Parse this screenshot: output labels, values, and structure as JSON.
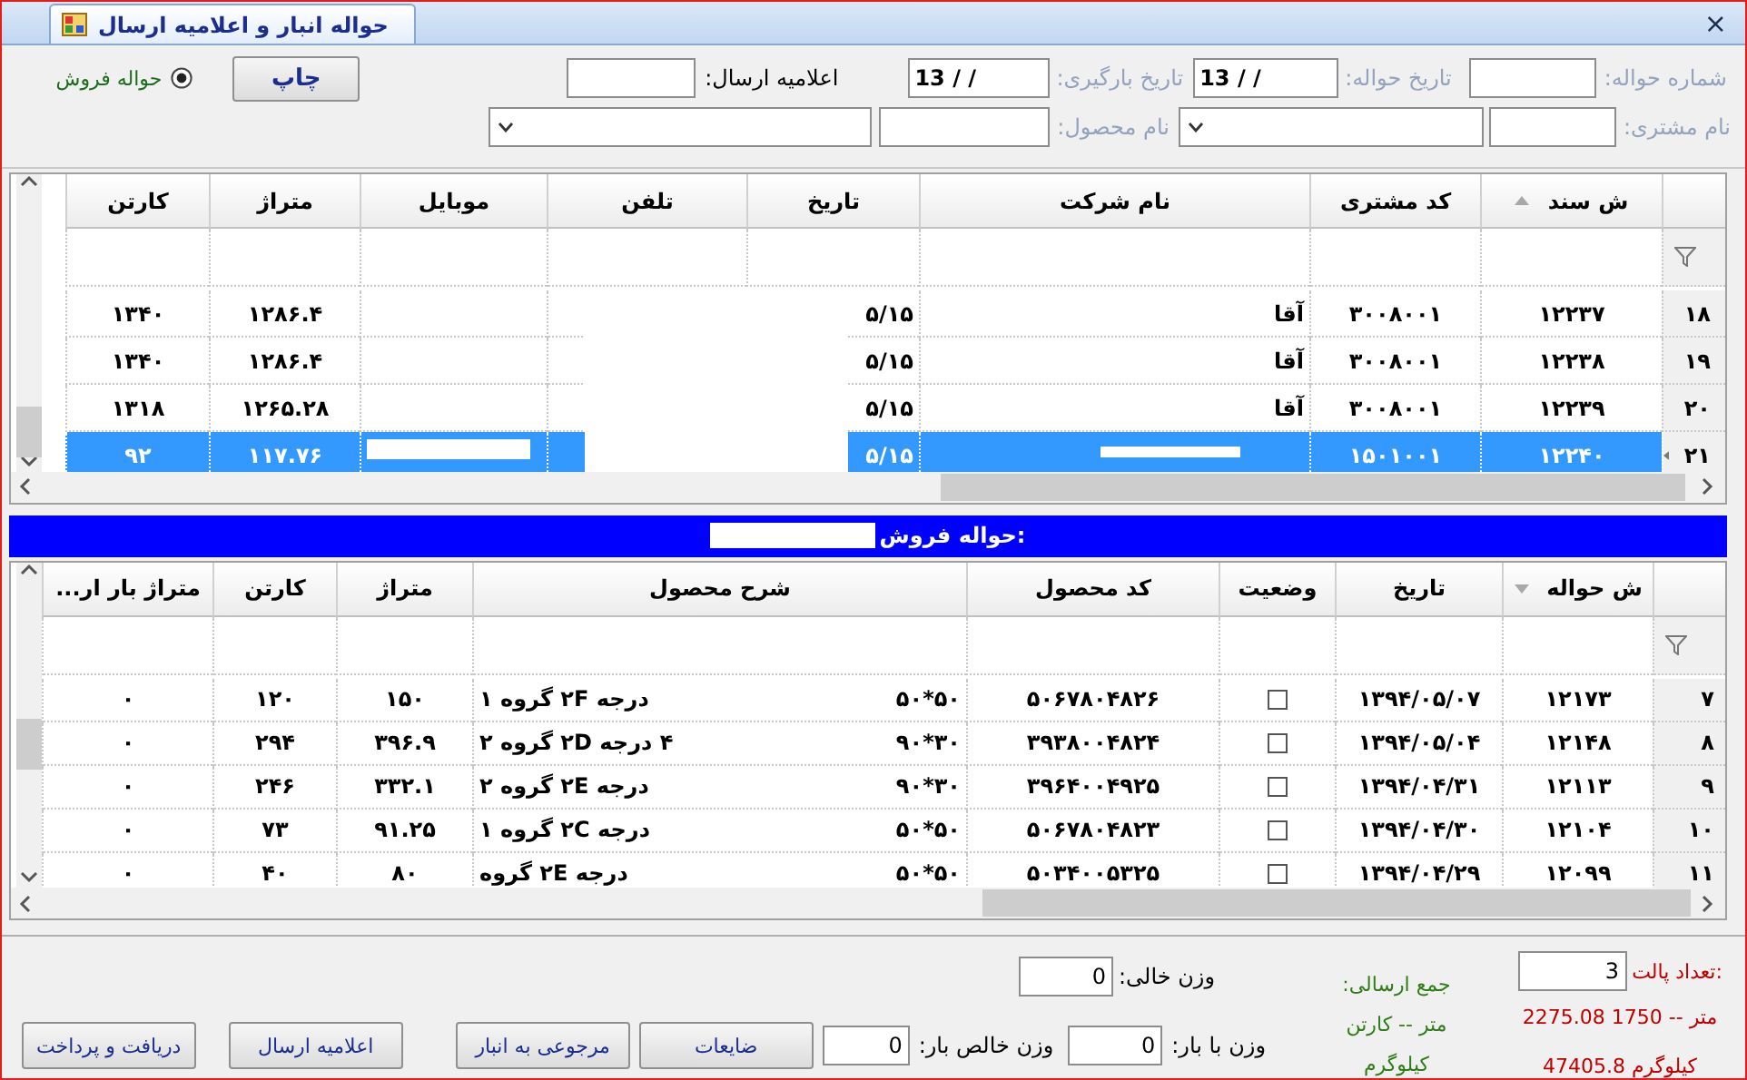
{
  "window": {
    "title": "حواله انبار و اعلامیه ارسال",
    "close": "×"
  },
  "form": {
    "invoice_no": {
      "label": "شماره حواله:",
      "disabled": true
    },
    "invoice_date": {
      "label": "تاریخ حواله:",
      "disabled": true,
      "value": "13 / /"
    },
    "loading_date": {
      "label": "تاریخ بارگیری:",
      "disabled": true,
      "value": "13 / /"
    },
    "dispatch_notice": {
      "label": "اعلامیه ارسال:",
      "disabled": false
    },
    "print_button": "چاپ",
    "radio": {
      "label": "حواله فروش",
      "selected": true
    },
    "customer": {
      "label": "نام مشتری:",
      "disabled": true
    },
    "product": {
      "label": "نام محصول:",
      "disabled": true
    }
  },
  "orders_grid": {
    "sort_descending": false,
    "columns": [
      {
        "label": "ش سند",
        "sorted": true,
        "kind": "center"
      },
      {
        "label": "کد مشتری",
        "sorted": false,
        "kind": "center"
      },
      {
        "label": "نام شرکت",
        "sorted": false,
        "kind": "start"
      },
      {
        "label": "تاریخ",
        "sorted": false,
        "kind": "start"
      },
      {
        "label": "تلفن",
        "sorted": false,
        "kind": "center"
      },
      {
        "label": "موبایل",
        "sorted": false,
        "kind": "center"
      },
      {
        "label": "متراژ",
        "sorted": false,
        "kind": "center"
      },
      {
        "label": "کارتن",
        "sorted": false,
        "kind": "center"
      }
    ],
    "rows": [
      {
        "number": "۱۸",
        "selected": false,
        "cells": [
          "۱۲۲۳۷",
          "۳۰۰۸۰۰۱",
          "آقا",
          "۵/۱۵",
          null,
          null,
          "۱۲۸۶.۴",
          "۱۳۴۰"
        ]
      },
      {
        "number": "۱۹",
        "selected": false,
        "cells": [
          "۱۲۲۳۸",
          "۳۰۰۸۰۰۱",
          "آقا",
          "۵/۱۵",
          null,
          null,
          "۱۲۸۶.۴",
          "۱۳۴۰"
        ]
      },
      {
        "number": "۲۰",
        "selected": false,
        "cells": [
          "۱۲۲۳۹",
          "۳۰۰۸۰۰۱",
          "آقا",
          "۵/۱۵",
          null,
          null,
          "۱۲۶۵.۲۸",
          "۱۳۱۸"
        ]
      },
      {
        "number": "۲۱",
        "selected": true,
        "cells": [
          "۱۲۲۴۰",
          "۱۵۰۱۰۰۱",
          null,
          "۵/۱۵",
          null,
          null,
          "۱۱۷.۷۶",
          "۹۲"
        ]
      }
    ]
  },
  "detail_bar": {
    "label": "حواله فروش:"
  },
  "items_grid": {
    "sort_descending": true,
    "columns": [
      {
        "label": "ش حواله",
        "sorted": true,
        "kind": "center"
      },
      {
        "label": "تاریخ",
        "sorted": false,
        "kind": "center"
      },
      {
        "label": "وضعیت",
        "sorted": false,
        "kind": "check"
      },
      {
        "label": "کد محصول",
        "sorted": false,
        "kind": "center"
      },
      {
        "label": "شرح محصول",
        "sorted": false,
        "kind": "desc"
      },
      {
        "label": "متراژ",
        "sorted": false,
        "kind": "center"
      },
      {
        "label": "کارتن",
        "sorted": false,
        "kind": "center"
      },
      {
        "label": "متراژ بار ار...",
        "sorted": false,
        "kind": "center"
      }
    ],
    "rows": [
      {
        "number": "۷",
        "selected": false,
        "cells": [
          "۱۲۱۷۳",
          "۱۳۹۴/۰۵/۰۷",
          {
            "checked": false
          },
          "۵۰۶۷۸۰۴۸۲۶",
          {
            "start": "۵۰*۵۰",
            "end": "درجه ۲F گروه ۱"
          },
          "۱۵۰",
          "۱۲۰",
          "۰"
        ]
      },
      {
        "number": "۸",
        "selected": false,
        "cells": [
          "۱۲۱۴۸",
          "۱۳۹۴/۰۵/۰۴",
          {
            "checked": false
          },
          "۳۹۳۸۰۰۴۸۲۴",
          {
            "start": "۳۰*۹۰",
            "end": "۴ درجه ۲D گروه ۲"
          },
          "۳۹۶.۹",
          "۲۹۴",
          "۰"
        ]
      },
      {
        "number": "۹",
        "selected": false,
        "cells": [
          "۱۲۱۱۳",
          "۱۳۹۴/۰۴/۳۱",
          {
            "checked": false
          },
          "۳۹۶۴۰۰۴۹۲۵",
          {
            "start": "۳۰*۹۰",
            "end": "درجه ۲E گروه ۲"
          },
          "۳۳۲.۱",
          "۲۴۶",
          "۰"
        ]
      },
      {
        "number": "۱۰",
        "selected": false,
        "cells": [
          "۱۲۱۰۴",
          "۱۳۹۴/۰۴/۳۰",
          {
            "checked": false
          },
          "۵۰۶۷۸۰۴۸۲۳",
          {
            "start": "۵۰*۵۰",
            "end": "درجه ۲C گروه ۱"
          },
          "۹۱.۲۵",
          "۷۳",
          "۰"
        ]
      },
      {
        "number": "۱۱",
        "selected": false,
        "cells": [
          "۱۲۰۹۹",
          "۱۳۹۴/۰۴/۲۹",
          {
            "checked": false
          },
          "۵۰۳۴۰۰۵۳۲۵",
          {
            "start": "۵۰*۵۰",
            "end": "درجه ۲E گروه"
          },
          "۸۰",
          "۴۰",
          "۰"
        ]
      }
    ]
  },
  "summary": {
    "pallet_count": {
      "label": "تعداد پالت:",
      "value": "3"
    },
    "total_meter": "2275.08 متر -- 1750",
    "total_weight": "47405.8 کیلوگرم",
    "sent_total": "جمع ارسالی:",
    "sent_meter": "متر -- کارتن",
    "sent_weight": "کیلوگرم",
    "empty_weight": {
      "label": "وزن خالی:",
      "value": "0"
    },
    "loaded_weight": {
      "label": "وزن با بار:",
      "value": "0"
    },
    "net_weight": {
      "label": "وزن خالص بار:",
      "value": "0"
    }
  },
  "buttons": [
    "ضایعات",
    "مرجوعی به انبار",
    "اعلامیه ارسال",
    "دریافت و پرداخت"
  ]
}
